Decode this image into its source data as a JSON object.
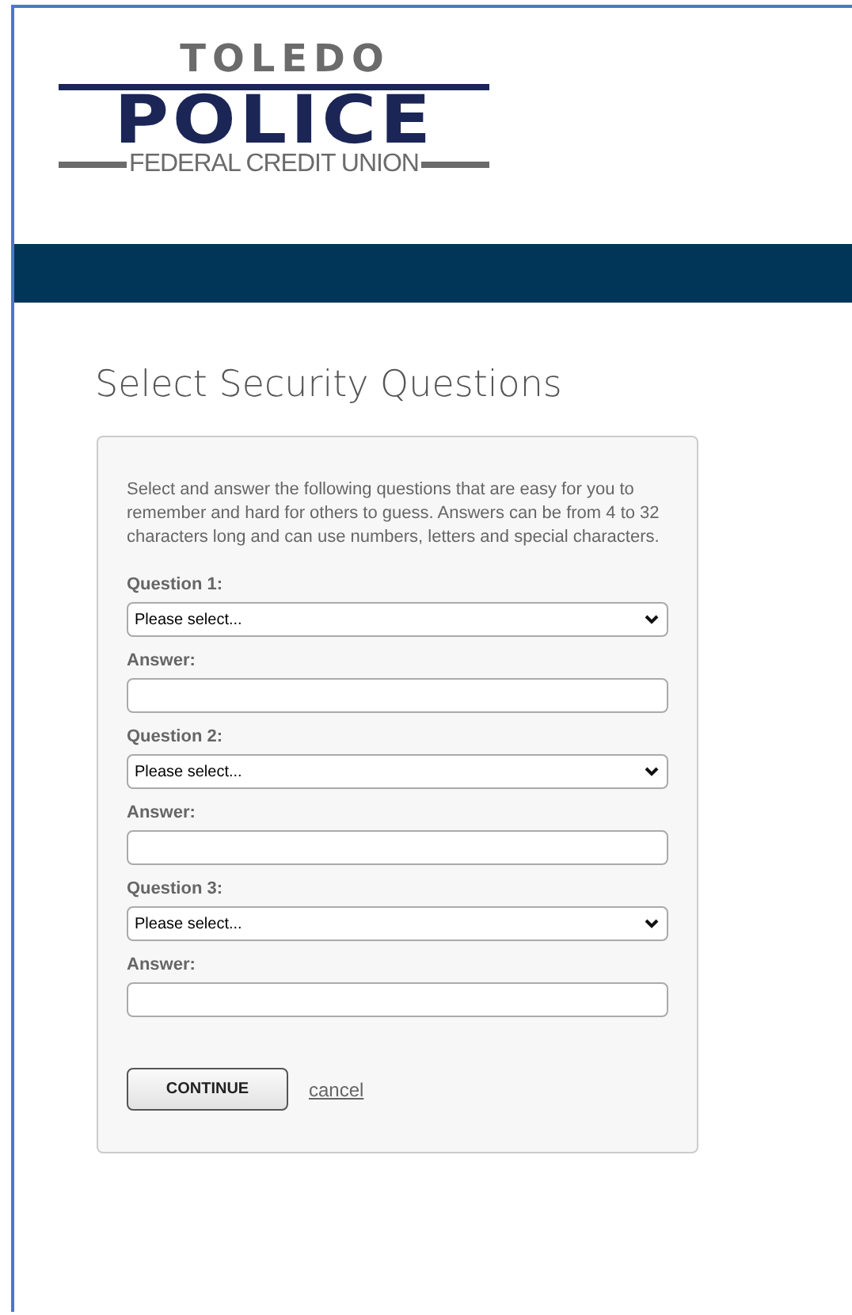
{
  "logo": {
    "top": "TOLEDO",
    "main": "POLICE",
    "sub": "FEDERAL CREDIT UNION"
  },
  "page_title": "Select Security Questions",
  "intro": "Select and answer the following questions that are easy for you to remember and hard for others to guess. Answers can be from 4 to 32 characters long and can use numbers, letters and special characters.",
  "questions": [
    {
      "label": "Question 1:",
      "select_value": "Please select...",
      "answer_label": "Answer:"
    },
    {
      "label": "Question 2:",
      "select_value": "Please select...",
      "answer_label": "Answer:"
    },
    {
      "label": "Question 3:",
      "select_value": "Please select...",
      "answer_label": "Answer:"
    }
  ],
  "buttons": {
    "continue": "CONTINUE",
    "cancel": "cancel"
  }
}
